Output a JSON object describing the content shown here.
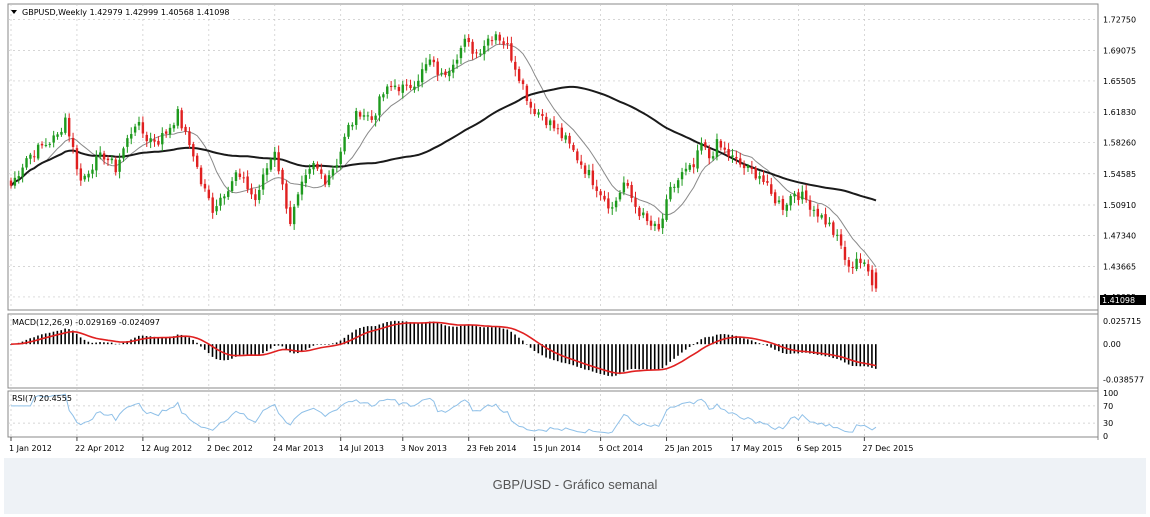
{
  "caption": "GBP/USD - Gráfico semanal",
  "colors": {
    "up": "#1e9a1e",
    "down": "#e02020",
    "ma_fast": "#8a8a8a",
    "ma_slow": "#1a1a1a",
    "macd_hist": "#000000",
    "macd_signal": "#e02020",
    "rsi": "#8fc0e8",
    "grid": "#c8c8c8"
  },
  "chart_data": [
    {
      "type": "candlestick",
      "header": "GBPUSD,Weekly  1.42979 1.42999 1.40568 1.41098",
      "y_ticks": [
        "1.72750",
        "1.69075",
        "1.65505",
        "1.61830",
        "1.58260",
        "1.54585",
        "1.50910",
        "1.47340",
        "1.43665",
        "1.40095"
      ],
      "ylim": [
        1.395,
        1.735
      ],
      "current_price": "1.41098",
      "x_ticks": [
        "1 Jan 2012",
        "22 Apr 2012",
        "12 Aug 2012",
        "2 Dec 2012",
        "24 Mar 2013",
        "14 Jul 2013",
        "3 Nov 2013",
        "23 Feb 2014",
        "15 Jun 2014",
        "5 Oct 2014",
        "25 Jan 2015",
        "17 May 2015",
        "6 Sep 2015",
        "27 Dec 2015"
      ],
      "close_anchors": [
        [
          0,
          1.532
        ],
        [
          4,
          1.565
        ],
        [
          8,
          1.578
        ],
        [
          12,
          1.59
        ],
        [
          14,
          1.612
        ],
        [
          16,
          1.575
        ],
        [
          18,
          1.537
        ],
        [
          21,
          1.557
        ],
        [
          24,
          1.568
        ],
        [
          27,
          1.552
        ],
        [
          29,
          1.575
        ],
        [
          32,
          1.606
        ],
        [
          35,
          1.588
        ],
        [
          38,
          1.585
        ],
        [
          40,
          1.595
        ],
        [
          43,
          1.616
        ],
        [
          45,
          1.59
        ],
        [
          47,
          1.57
        ],
        [
          49,
          1.535
        ],
        [
          52,
          1.505
        ],
        [
          55,
          1.525
        ],
        [
          58,
          1.545
        ],
        [
          61,
          1.53
        ],
        [
          63,
          1.515
        ],
        [
          66,
          1.553
        ],
        [
          68,
          1.575
        ],
        [
          70,
          1.53
        ],
        [
          72,
          1.49
        ],
        [
          75,
          1.53
        ],
        [
          78,
          1.555
        ],
        [
          81,
          1.54
        ],
        [
          84,
          1.56
        ],
        [
          87,
          1.6
        ],
        [
          90,
          1.62
        ],
        [
          93,
          1.61
        ],
        [
          96,
          1.64
        ],
        [
          99,
          1.65
        ],
        [
          102,
          1.645
        ],
        [
          105,
          1.66
        ],
        [
          108,
          1.678
        ],
        [
          111,
          1.66
        ],
        [
          114,
          1.68
        ],
        [
          117,
          1.7
        ],
        [
          120,
          1.688
        ],
        [
          123,
          1.705
        ],
        [
          125,
          1.712
        ],
        [
          128,
          1.695
        ],
        [
          131,
          1.662
        ],
        [
          134,
          1.625
        ],
        [
          137,
          1.615
        ],
        [
          140,
          1.6
        ],
        [
          143,
          1.585
        ],
        [
          146,
          1.565
        ],
        [
          149,
          1.545
        ],
        [
          152,
          1.525
        ],
        [
          155,
          1.505
        ],
        [
          158,
          1.535
        ],
        [
          161,
          1.508
        ],
        [
          164,
          1.488
        ],
        [
          167,
          1.478
        ],
        [
          170,
          1.525
        ],
        [
          173,
          1.545
        ],
        [
          176,
          1.553
        ],
        [
          178,
          1.58
        ],
        [
          180,
          1.565
        ],
        [
          182,
          1.58
        ],
        [
          184,
          1.572
        ],
        [
          187,
          1.56
        ],
        [
          190,
          1.55
        ],
        [
          193,
          1.545
        ],
        [
          196,
          1.52
        ],
        [
          199,
          1.508
        ],
        [
          202,
          1.525
        ],
        [
          205,
          1.515
        ],
        [
          208,
          1.5
        ],
        [
          211,
          1.485
        ],
        [
          214,
          1.46
        ],
        [
          216,
          1.432
        ],
        [
          218,
          1.448
        ],
        [
          221,
          1.43
        ],
        [
          223,
          1.411
        ]
      ],
      "bars": 224,
      "moving_averages": [
        {
          "period": 10
        },
        {
          "period": 60
        }
      ]
    },
    {
      "type": "histogram",
      "header": "MACD(12,26,9) -0.029169 -0.024097",
      "y_ticks": [
        "0.025715",
        "0.00",
        "-0.038577"
      ],
      "ylim": [
        -0.046,
        0.031
      ]
    },
    {
      "type": "line",
      "header": "RSI(7) 20.4555",
      "y_ticks": [
        "100",
        "70",
        "30",
        "0"
      ],
      "ylim": [
        0,
        100
      ]
    }
  ]
}
